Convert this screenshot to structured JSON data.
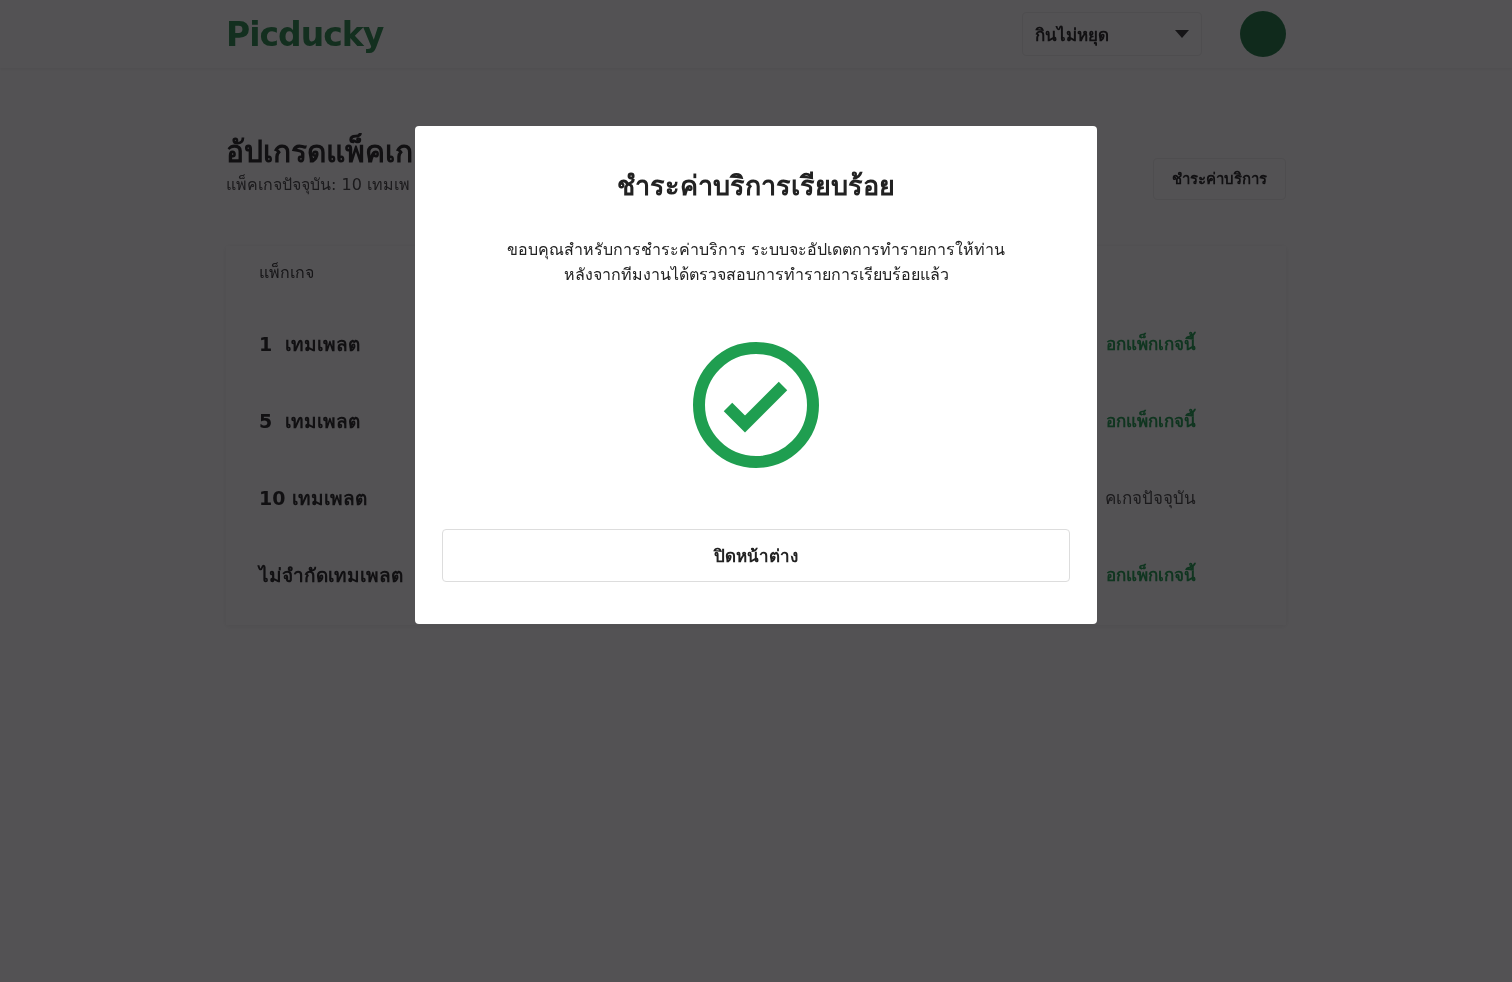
{
  "header": {
    "logo": "Picducky",
    "account_menu": {
      "label": "กินไม่หยุด"
    }
  },
  "page": {
    "title": "อัปเกรดแพ็คเก",
    "subtitle": "แพ็คเกจปัจจุบัน: 10 เทมเพ",
    "pay_button": "ชำระค่าบริการ",
    "table": {
      "columns": [
        "แพ็กเกจ"
      ],
      "rows": [
        {
          "name": "1  เทมเพลต",
          "action": "อกแพ็กเกจนี้",
          "kind": "link"
        },
        {
          "name": "5  เทมเพลต",
          "action": "อกแพ็กเกจนี้",
          "kind": "link"
        },
        {
          "name": "10 เทมเพลต",
          "action": "คเกจปัจจุบัน",
          "kind": "current"
        },
        {
          "name": "ไม่จำกัดเทมเพลต",
          "action": "อกแพ็กเกจนี้",
          "kind": "link"
        }
      ]
    }
  },
  "modal": {
    "title": "ชำระค่าบริการเรียบร้อย",
    "message": "ขอบคุณสำหรับการชำระค่าบริการ ระบบจะอัปเดตการทำรายการให้ท่าน\nหลังจากทีมงานได้ตรวจสอบการทำรายการเรียบร้อยแล้ว",
    "close_button": "ปิดหน้าต่าง"
  }
}
